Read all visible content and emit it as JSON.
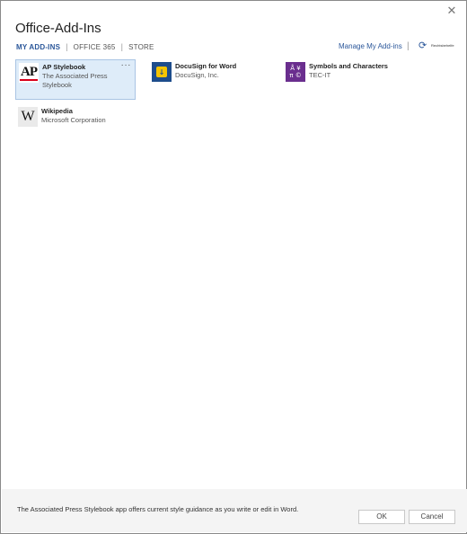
{
  "dialog": {
    "title": "Office-Add-Ins",
    "close_glyph": "✕"
  },
  "tabs": [
    {
      "label": "MY ADD-INS",
      "active": true
    },
    {
      "label": "OFFICE 365",
      "active": false
    },
    {
      "label": "STORE",
      "active": false
    }
  ],
  "tab_separator": "|",
  "header": {
    "manage_link": "Manage My Add-ins",
    "separator": "|",
    "refresh_label": "Rechtsbehelfe",
    "refresh_icon": "refresh-icon"
  },
  "addins": [
    {
      "name": "AP Stylebook",
      "publisher_line1": "The Associated Press",
      "publisher_line2": "Stylebook",
      "icon": "ap-logo",
      "icon_text": "AP",
      "selected": true,
      "more": "···"
    },
    {
      "name": "DocuSign for Word",
      "publisher_line1": "DocuSign, Inc.",
      "icon": "docusign-logo",
      "icon_text": "↓"
    },
    {
      "name": "Symbols and Characters",
      "publisher_line1": "TEC-IT",
      "icon": "symbols-logo",
      "icon_text_1": "Å ¥",
      "icon_text_2": "π ©"
    },
    {
      "name": "Wikipedia",
      "publisher_line1": "Microsoft Corporation",
      "icon": "wikipedia-logo",
      "icon_text": "W"
    }
  ],
  "footer": {
    "description": "The Associated Press Stylebook app offers current style guidance as you write or edit in Word.",
    "ok_label": "OK",
    "cancel_label": "Cancel"
  },
  "colors": {
    "accent": "#2b579a",
    "selected_bg": "#deecf9",
    "ap_red": "#d9001b",
    "docusign_blue": "#1e4d8c",
    "docusign_yellow": "#f5c400",
    "symbols_purple": "#6a2e8e"
  }
}
